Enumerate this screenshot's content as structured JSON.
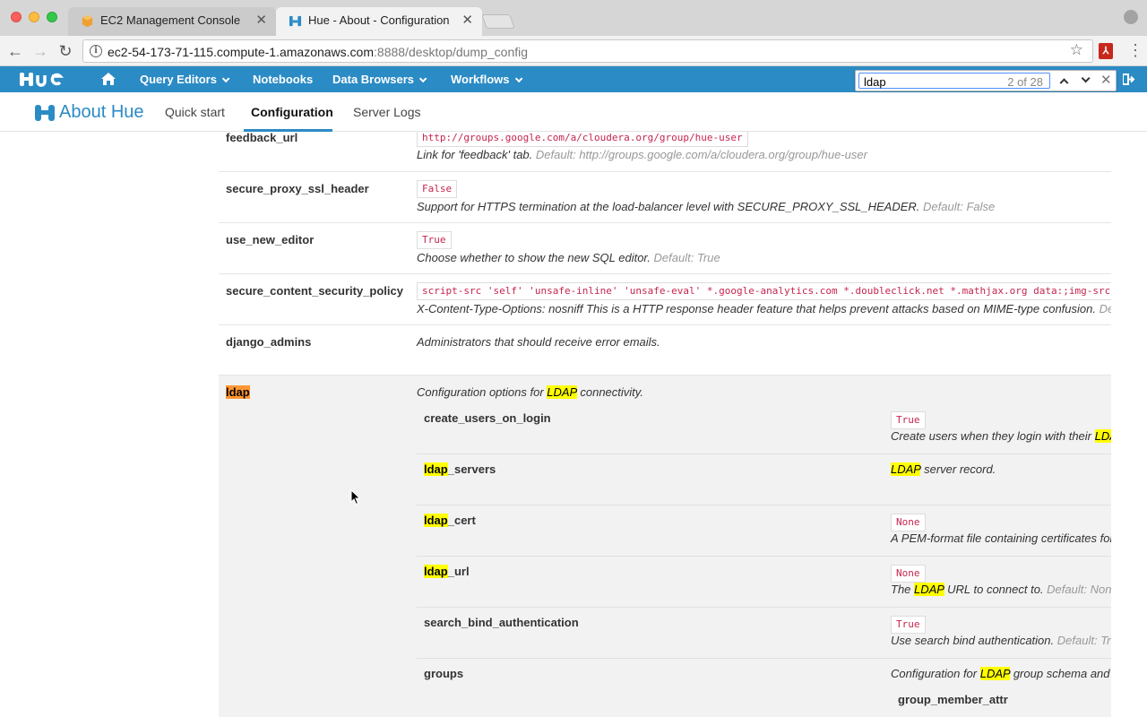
{
  "browser": {
    "tabs": [
      {
        "title": "EC2 Management Console",
        "active": false
      },
      {
        "title": "Hue - About - Configuration",
        "active": true
      }
    ],
    "url_main": "ec2-54-173-71-115.compute-1.amazonaws.com",
    "url_rest": ":8888/desktop/dump_config"
  },
  "find": {
    "query": "ldap",
    "count": "2 of 28"
  },
  "hue": {
    "logo": "HUE",
    "menus": [
      "Query Editors",
      "Notebooks",
      "Data Browsers",
      "Workflows"
    ],
    "page_title": "About Hue",
    "subtabs": [
      "Quick start",
      "Configuration",
      "Server Logs"
    ],
    "accent": "#2b8bc5"
  },
  "config": {
    "rows": [
      {
        "key": "feedback_url",
        "value": "http://groups.google.com/a/cloudera.org/group/hue-user",
        "desc": "Link for 'feedback' tab.",
        "default_label": "Default:",
        "default_value": "http://groups.google.com/a/cloudera.org/group/hue-user"
      },
      {
        "key": "secure_proxy_ssl_header",
        "value": "False",
        "desc": "Support for HTTPS termination at the load-balancer level with SECURE_PROXY_SSL_HEADER.",
        "default_label": "Default:",
        "default_value": "False"
      },
      {
        "key": "use_new_editor",
        "value": "True",
        "desc": "Choose whether to show the new SQL editor.",
        "default_label": "Default:",
        "default_value": "True"
      },
      {
        "key": "secure_content_security_policy",
        "value": "script-src 'self' 'unsafe-inline' 'unsafe-eval' *.google-analytics.com *.doubleclick.net *.mathjax.org data:;img-src",
        "desc": "X-Content-Type-Options: nosniff This is a HTTP response header feature that helps prevent attacks based on MIME-type confusion.",
        "default_label": "Defau"
      },
      {
        "key": "django_admins",
        "desc": "Administrators that should receive error emails."
      }
    ],
    "ldap": {
      "key": "ldap",
      "desc_pre": "Configuration options for ",
      "desc_mark": "LDAP",
      "desc_post": " connectivity.",
      "children": [
        {
          "key_mark": "",
          "key_rest": "create_users_on_login",
          "value": "True",
          "desc_pre": "Create users when they login with their ",
          "desc_mark": "LDA",
          "desc_post": ""
        },
        {
          "key_mark": "ldap",
          "key_rest": "_servers",
          "desc_pre": "",
          "desc_mark": "LDAP",
          "desc_post": " server record."
        },
        {
          "key_mark": "ldap",
          "key_rest": "_cert",
          "value": "None",
          "desc_pre": "A PEM-format file containing certificates for",
          "desc_mark": "",
          "desc_post": ""
        },
        {
          "key_mark": "ldap",
          "key_rest": "_url",
          "value": "None",
          "desc_pre": "The ",
          "desc_mark": "LDAP",
          "desc_post": " URL to connect to.",
          "default_label": "Default:",
          "default_value": "None"
        },
        {
          "key_mark": "",
          "key_rest": "search_bind_authentication",
          "value": "True",
          "desc_pre": "Use search bind authentication.",
          "desc_mark": "",
          "desc_post": "",
          "default_label": "Default:",
          "default_value": "Tru"
        },
        {
          "key_mark": "",
          "key_rest": "groups",
          "desc_pre": "Configuration for ",
          "desc_mark": "LDAP",
          "desc_post": " group schema and s"
        }
      ],
      "nested_key": "group_member_attr"
    }
  }
}
